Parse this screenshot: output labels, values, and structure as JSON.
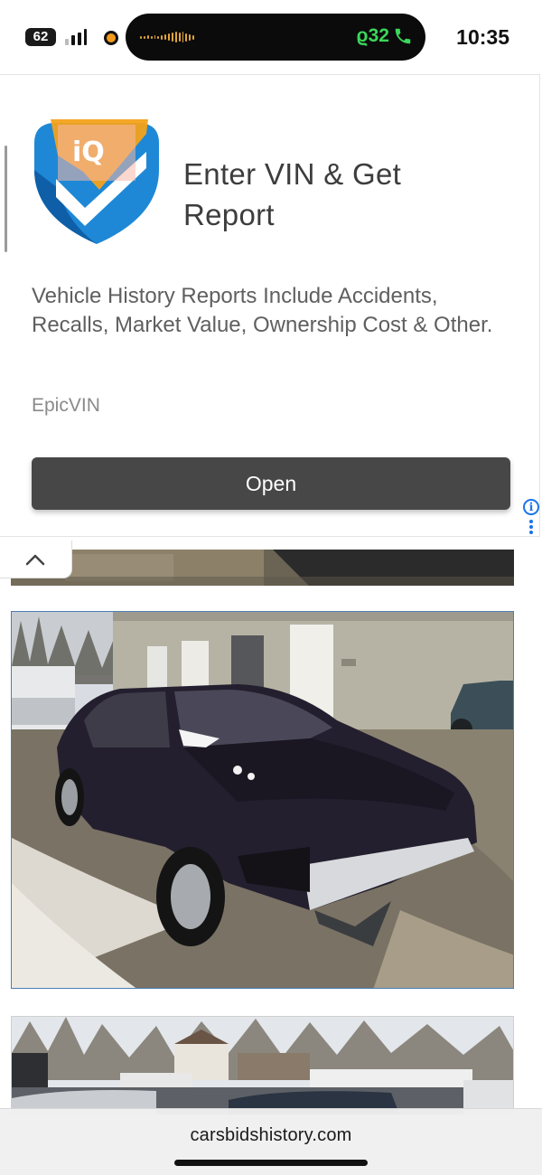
{
  "status_bar": {
    "notification_count": "62",
    "call_timer": "ϱ32",
    "time": "10:35",
    "icons": [
      "notification-badge-icon",
      "signal-bars-icon",
      "recording-dot-icon",
      "audio-wave-icon",
      "phone-icon"
    ]
  },
  "ad": {
    "title": "Enter VIN & Get Report",
    "description": "Vehicle History Reports Include Accidents, Recalls, Market Value, Ownership Cost & Other.",
    "source": "EpicVIN",
    "open_label": "Open",
    "logo_text": "iQ",
    "info_label": "i",
    "colors": {
      "button": "#474747",
      "logo_blue": "#1e88d6",
      "logo_orange": "#f4a21b",
      "adchoices": "#1a73e8"
    }
  },
  "collapse_tab": {
    "icon": "chevron-up-icon"
  },
  "photos": {
    "strip": "vehicle-photo-partial",
    "main": "damaged-sedan-photo",
    "second": "parking-lot-photo"
  },
  "browser": {
    "url": "carsbidshistory.com"
  }
}
